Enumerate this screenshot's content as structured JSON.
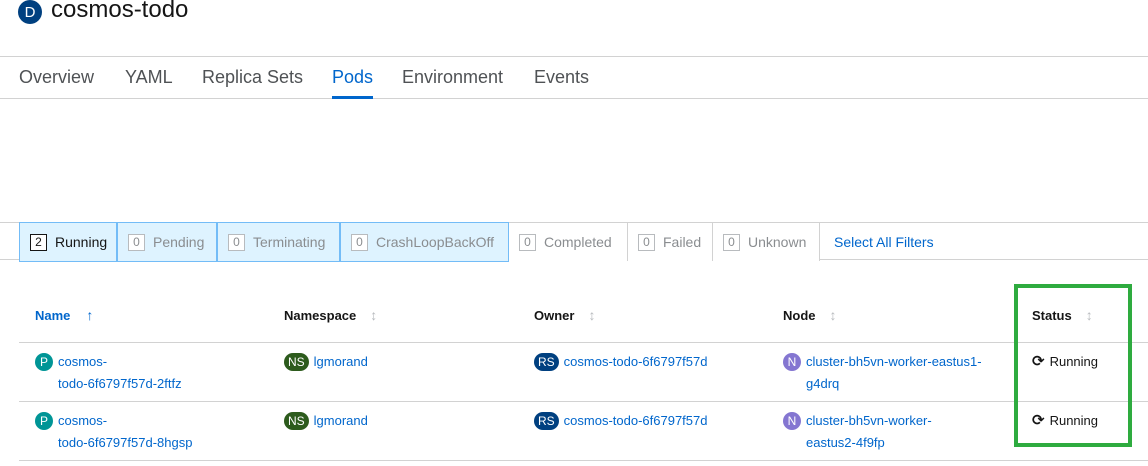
{
  "header": {
    "resource_badge": "D",
    "title": "cosmos-todo"
  },
  "tabs": [
    "Overview",
    "YAML",
    "Replica Sets",
    "Pods",
    "Environment",
    "Events"
  ],
  "active_tab": "Pods",
  "filters": [
    {
      "count": "2",
      "label": "Running"
    },
    {
      "count": "0",
      "label": "Pending"
    },
    {
      "count": "0",
      "label": "Terminating"
    },
    {
      "count": "0",
      "label": "CrashLoopBackOff"
    },
    {
      "count": "0",
      "label": "Completed"
    },
    {
      "count": "0",
      "label": "Failed"
    },
    {
      "count": "0",
      "label": "Unknown"
    }
  ],
  "select_all_label": "Select All Filters",
  "columns": [
    "Name",
    "Namespace",
    "Owner",
    "Node",
    "Status"
  ],
  "rows": [
    {
      "pod_badge": "P",
      "name_line1": "cosmos-",
      "name_line2": "todo-6f6797f57d-2ftfz",
      "ns_badge": "NS",
      "namespace": "lgmorand",
      "owner_badge": "RS",
      "owner": "cosmos-todo-6f6797f57d",
      "node_badge": "N",
      "node_line1": "cluster-bh5vn-worker-eastus1-",
      "node_line2": "g4drq",
      "status": "Running"
    },
    {
      "pod_badge": "P",
      "name_line1": "cosmos-",
      "name_line2": "todo-6f6797f57d-8hgsp",
      "ns_badge": "NS",
      "namespace": "lgmorand",
      "owner_badge": "RS",
      "owner": "cosmos-todo-6f6797f57d",
      "node_badge": "N",
      "node_line1": "cluster-bh5vn-worker-",
      "node_line2": "eastus2-4f9fp",
      "status": "Running"
    }
  ],
  "icons": {
    "sort_asc": "arrow-up-icon",
    "sort_neutral": "sort-icon",
    "status": "sync-icon"
  },
  "colors": {
    "accent": "#0066cc",
    "pod_badge": "#009596",
    "namespace_badge": "#2d5b1d",
    "owner_badge": "#004080",
    "node_badge": "#8476d1",
    "highlight_box": "#2eab3f"
  }
}
